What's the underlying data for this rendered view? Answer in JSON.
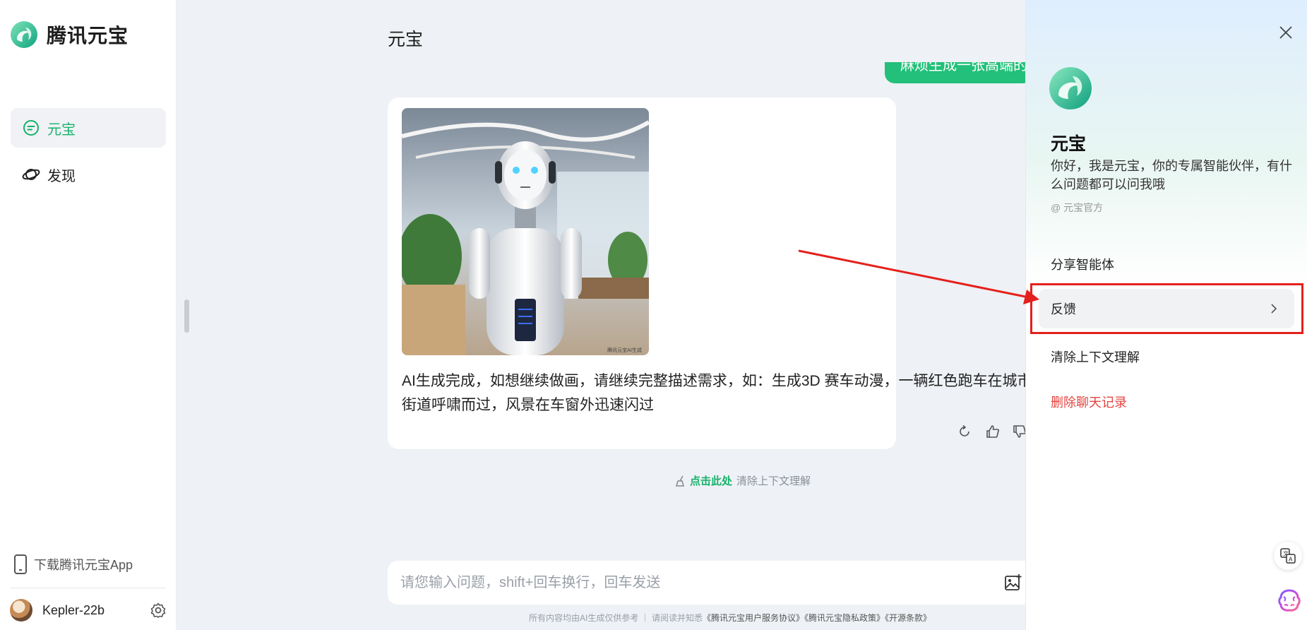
{
  "brand": {
    "name": "腾讯元宝",
    "logo_icon": "yuanbao-logo-icon"
  },
  "sidebar": {
    "nav": [
      {
        "label": "元宝",
        "icon": "chat-bubble-icon",
        "active": true
      },
      {
        "label": "发现",
        "icon": "planet-icon",
        "active": false
      }
    ],
    "download_app": "下载腾讯元宝App",
    "user": {
      "name": "Kepler-22b"
    }
  },
  "chat": {
    "title": "元宝",
    "user_message": "麻烦生成一张高端的",
    "answer_text": "AI生成完成，如想继续做画，请继续完整描述需求，如：生成3D 赛车动漫，一辆红色跑车在城市街道呼啸而过，风景在车窗外迅速闪过",
    "image_watermark": "腾讯元宝AI生成",
    "clear_hint_link": "点击此处",
    "clear_hint_text": "清除上下文理解"
  },
  "input": {
    "placeholder": "请您输入问题，shift+回车换行，回车发送"
  },
  "footer": {
    "note": "所有内容均由AI生成仅供参考 ｜ 请阅读并知悉",
    "links": "《腾讯元宝用户服务协议》《腾讯元宝隐私政策》《开源条款》"
  },
  "panel": {
    "agent_name": "元宝",
    "agent_desc": "你好，我是元宝，你的专属智能伙伴，有什么问题都可以问我哦",
    "agent_source": "@ 元宝官方",
    "items": {
      "share": "分享智能体",
      "feedback": "反馈",
      "clear_context": "清除上下文理解",
      "delete_history": "删除聊天记录"
    }
  },
  "colors": {
    "accent": "#17b26a",
    "danger": "#e5443f",
    "annotation": "#e4201c"
  }
}
